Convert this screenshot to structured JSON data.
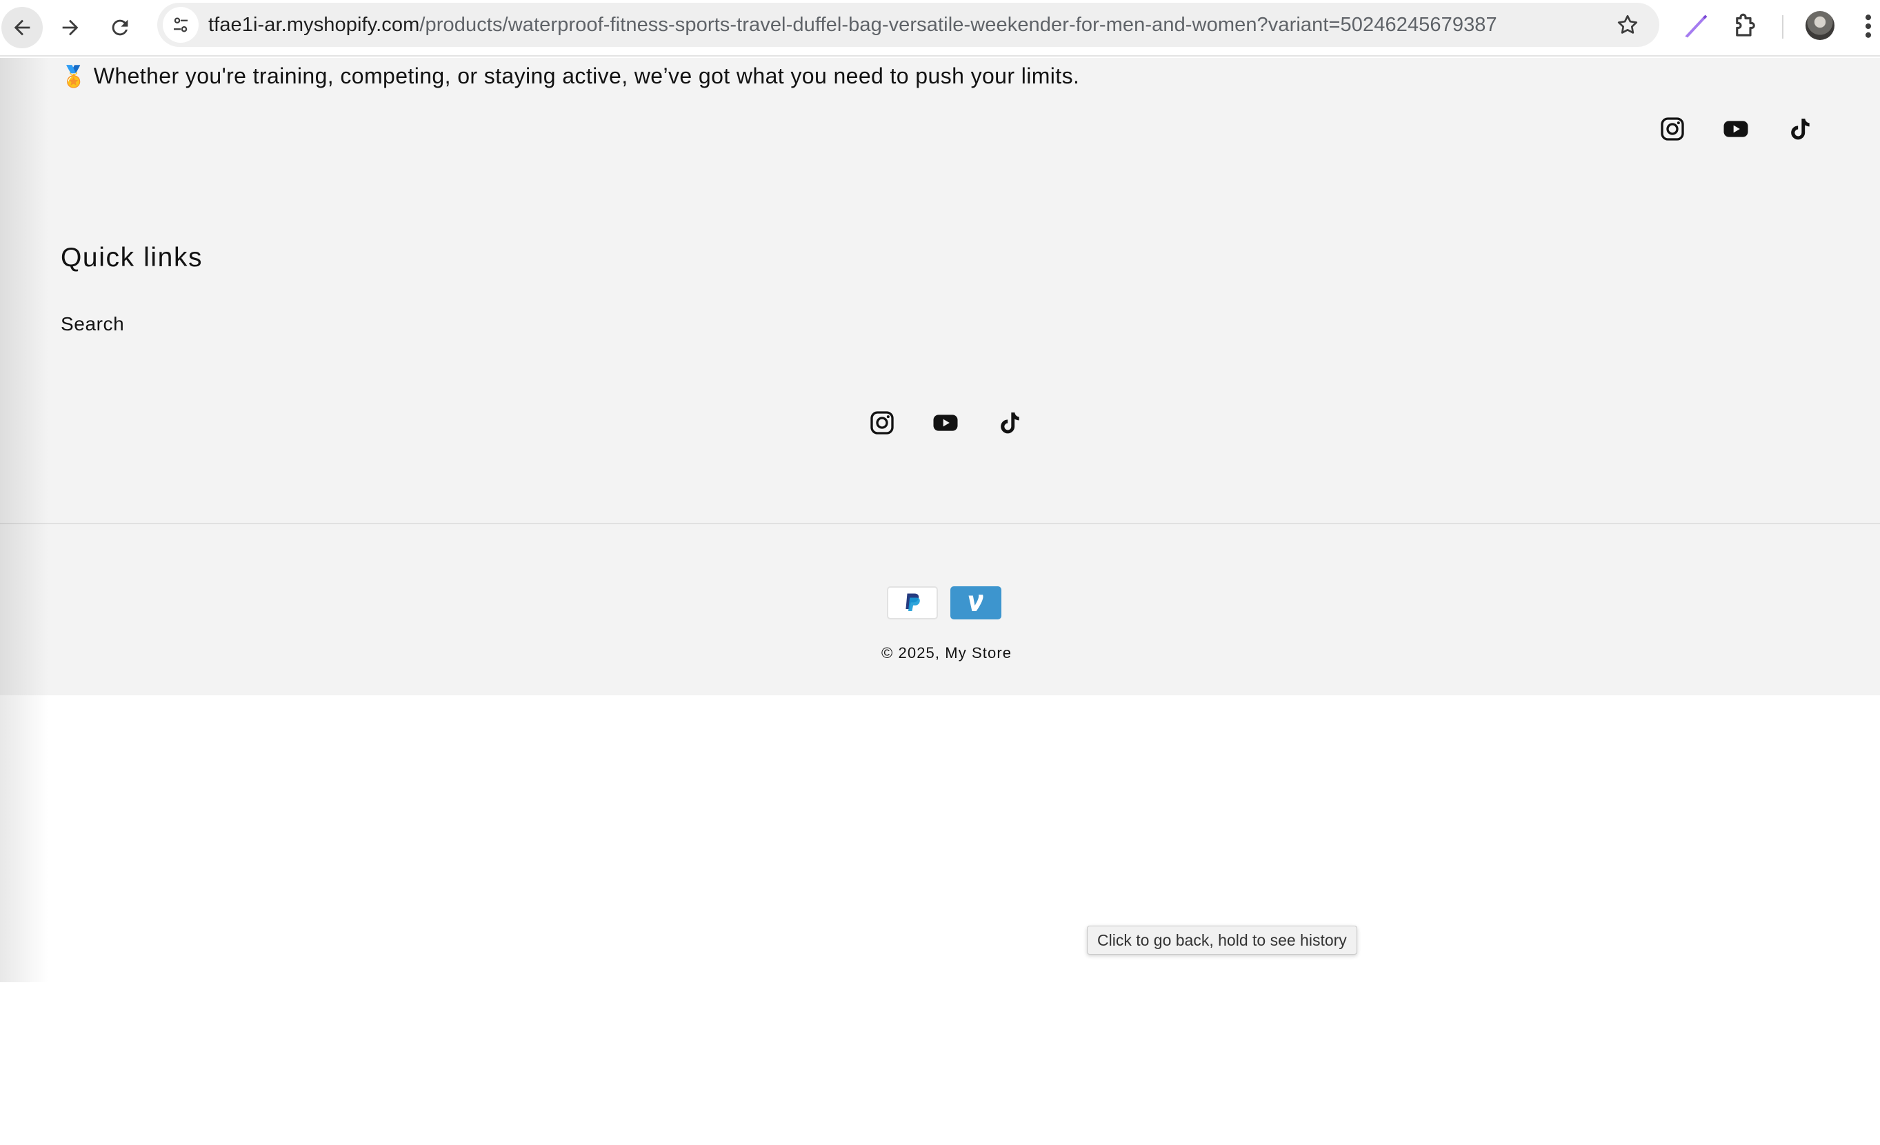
{
  "browser": {
    "url_host": "tfae1i-ar.myshopify.com",
    "url_path": "/products/waterproof-fitness-sports-travel-duffel-bag-versatile-weekender-for-men-and-women?variant=50246245679387",
    "tooltip": "Click to go back, hold to see history"
  },
  "footer": {
    "tagline_emoji": "🏅",
    "tagline": "Whether you're training, competing, or staying active, we’ve got what you need to push your limits.",
    "social_icons": [
      "instagram-icon",
      "youtube-icon",
      "tiktok-icon"
    ],
    "quick_links": {
      "title": "Quick links",
      "items": [
        "Search"
      ]
    },
    "payment_methods": [
      "PayPal",
      "Venmo"
    ],
    "copyright": "© 2025, My Store"
  },
  "colors": {
    "footer_bg": "#f3f3f3",
    "text": "#121212",
    "venmo": "#3d95ce",
    "paypal_dark": "#253b80",
    "paypal_light": "#179bd7"
  }
}
